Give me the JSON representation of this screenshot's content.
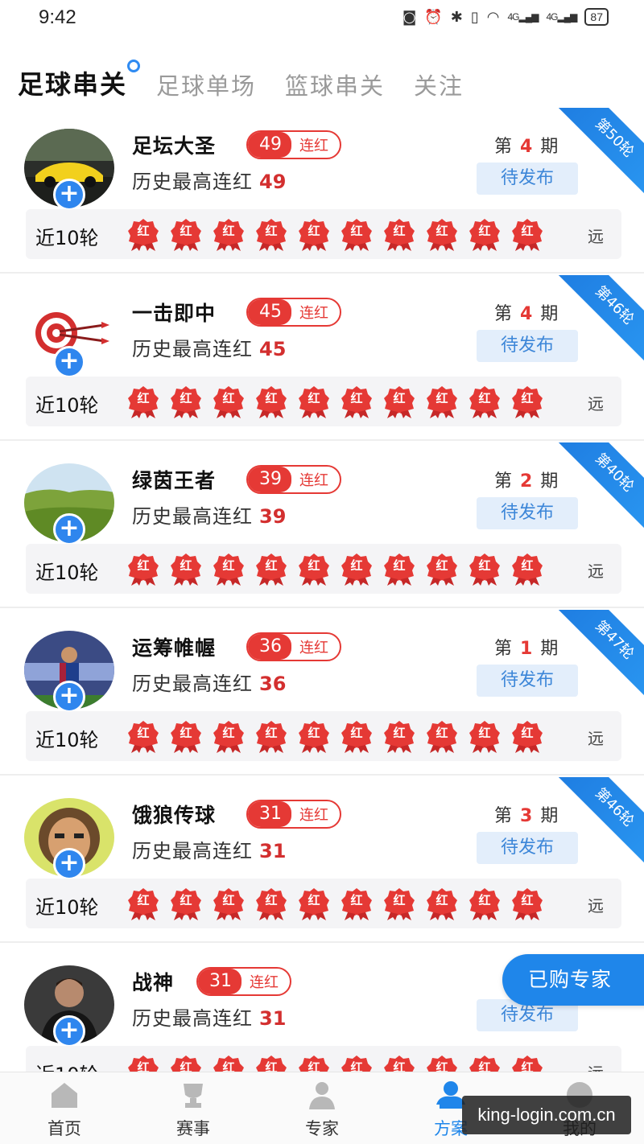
{
  "status_bar": {
    "time": "9:42",
    "battery": "87",
    "signal1": "4G",
    "signal2": "4G"
  },
  "tabs": [
    {
      "label": "足球串关",
      "active": true
    },
    {
      "label": "足球单场",
      "active": false
    },
    {
      "label": "篮球串关",
      "active": false
    },
    {
      "label": "关注",
      "active": false
    }
  ],
  "experts": [
    {
      "name": "足坛大圣",
      "streak": "49",
      "streak_label": "连红",
      "history_label": "历史最高连红",
      "history_max": "49",
      "period_prefix": "第",
      "period": "4",
      "period_suffix": "期",
      "status": "待发布",
      "ribbon": "第50轮",
      "recent_label": "近10轮",
      "results": [
        "红",
        "红",
        "红",
        "红",
        "红",
        "红",
        "红",
        "红",
        "红",
        "红"
      ],
      "far_label": "远",
      "avatar": "car"
    },
    {
      "name": "一击即中",
      "streak": "45",
      "streak_label": "连红",
      "history_label": "历史最高连红",
      "history_max": "45",
      "period_prefix": "第",
      "period": "4",
      "period_suffix": "期",
      "status": "待发布",
      "ribbon": "第46轮",
      "recent_label": "近10轮",
      "results": [
        "红",
        "红",
        "红",
        "红",
        "红",
        "红",
        "红",
        "红",
        "红",
        "红"
      ],
      "far_label": "远",
      "avatar": "target"
    },
    {
      "name": "绿茵王者",
      "streak": "39",
      "streak_label": "连红",
      "history_label": "历史最高连红",
      "history_max": "39",
      "period_prefix": "第",
      "period": "2",
      "period_suffix": "期",
      "status": "待发布",
      "ribbon": "第40轮",
      "recent_label": "近10轮",
      "results": [
        "红",
        "红",
        "红",
        "红",
        "红",
        "红",
        "红",
        "红",
        "红",
        "红"
      ],
      "far_label": "远",
      "avatar": "field"
    },
    {
      "name": "运筹帷幄",
      "streak": "36",
      "streak_label": "连红",
      "history_label": "历史最高连红",
      "history_max": "36",
      "period_prefix": "第",
      "period": "1",
      "period_suffix": "期",
      "status": "待发布",
      "ribbon": "第47轮",
      "recent_label": "近10轮",
      "results": [
        "红",
        "红",
        "红",
        "红",
        "红",
        "红",
        "红",
        "红",
        "红",
        "红"
      ],
      "far_label": "远",
      "avatar": "player"
    },
    {
      "name": "饿狼传球",
      "streak": "31",
      "streak_label": "连红",
      "history_label": "历史最高连红",
      "history_max": "31",
      "period_prefix": "第",
      "period": "3",
      "period_suffix": "期",
      "status": "待发布",
      "ribbon": "第46轮",
      "recent_label": "近10轮",
      "results": [
        "红",
        "红",
        "红",
        "红",
        "红",
        "红",
        "红",
        "红",
        "红",
        "红"
      ],
      "far_label": "远",
      "avatar": "cartoon"
    },
    {
      "name": "战神",
      "streak": "31",
      "streak_label": "连红",
      "history_label": "历史最高连红",
      "history_max": "31",
      "period_prefix": "第",
      "period": "",
      "period_suffix": "",
      "status": "待发布",
      "ribbon": "",
      "recent_label": "近10轮",
      "results": [
        "红",
        "红",
        "红",
        "红",
        "红",
        "红",
        "红",
        "红",
        "红",
        "红"
      ],
      "far_label": "远",
      "avatar": "man"
    }
  ],
  "float_button": "已购专家",
  "bottom_nav": [
    {
      "label": "首页",
      "icon": "home-icon",
      "active": false
    },
    {
      "label": "赛事",
      "icon": "trophy-icon",
      "active": false
    },
    {
      "label": "专家",
      "icon": "expert-icon",
      "active": false
    },
    {
      "label": "方案",
      "icon": "plan-icon",
      "active": true
    },
    {
      "label": "我的",
      "icon": "profile-icon",
      "active": false
    }
  ],
  "watermark": "king-login.com.cn",
  "colors": {
    "accent": "#1f86ea",
    "red": "#e53935",
    "pending_bg": "#e3eefb"
  }
}
